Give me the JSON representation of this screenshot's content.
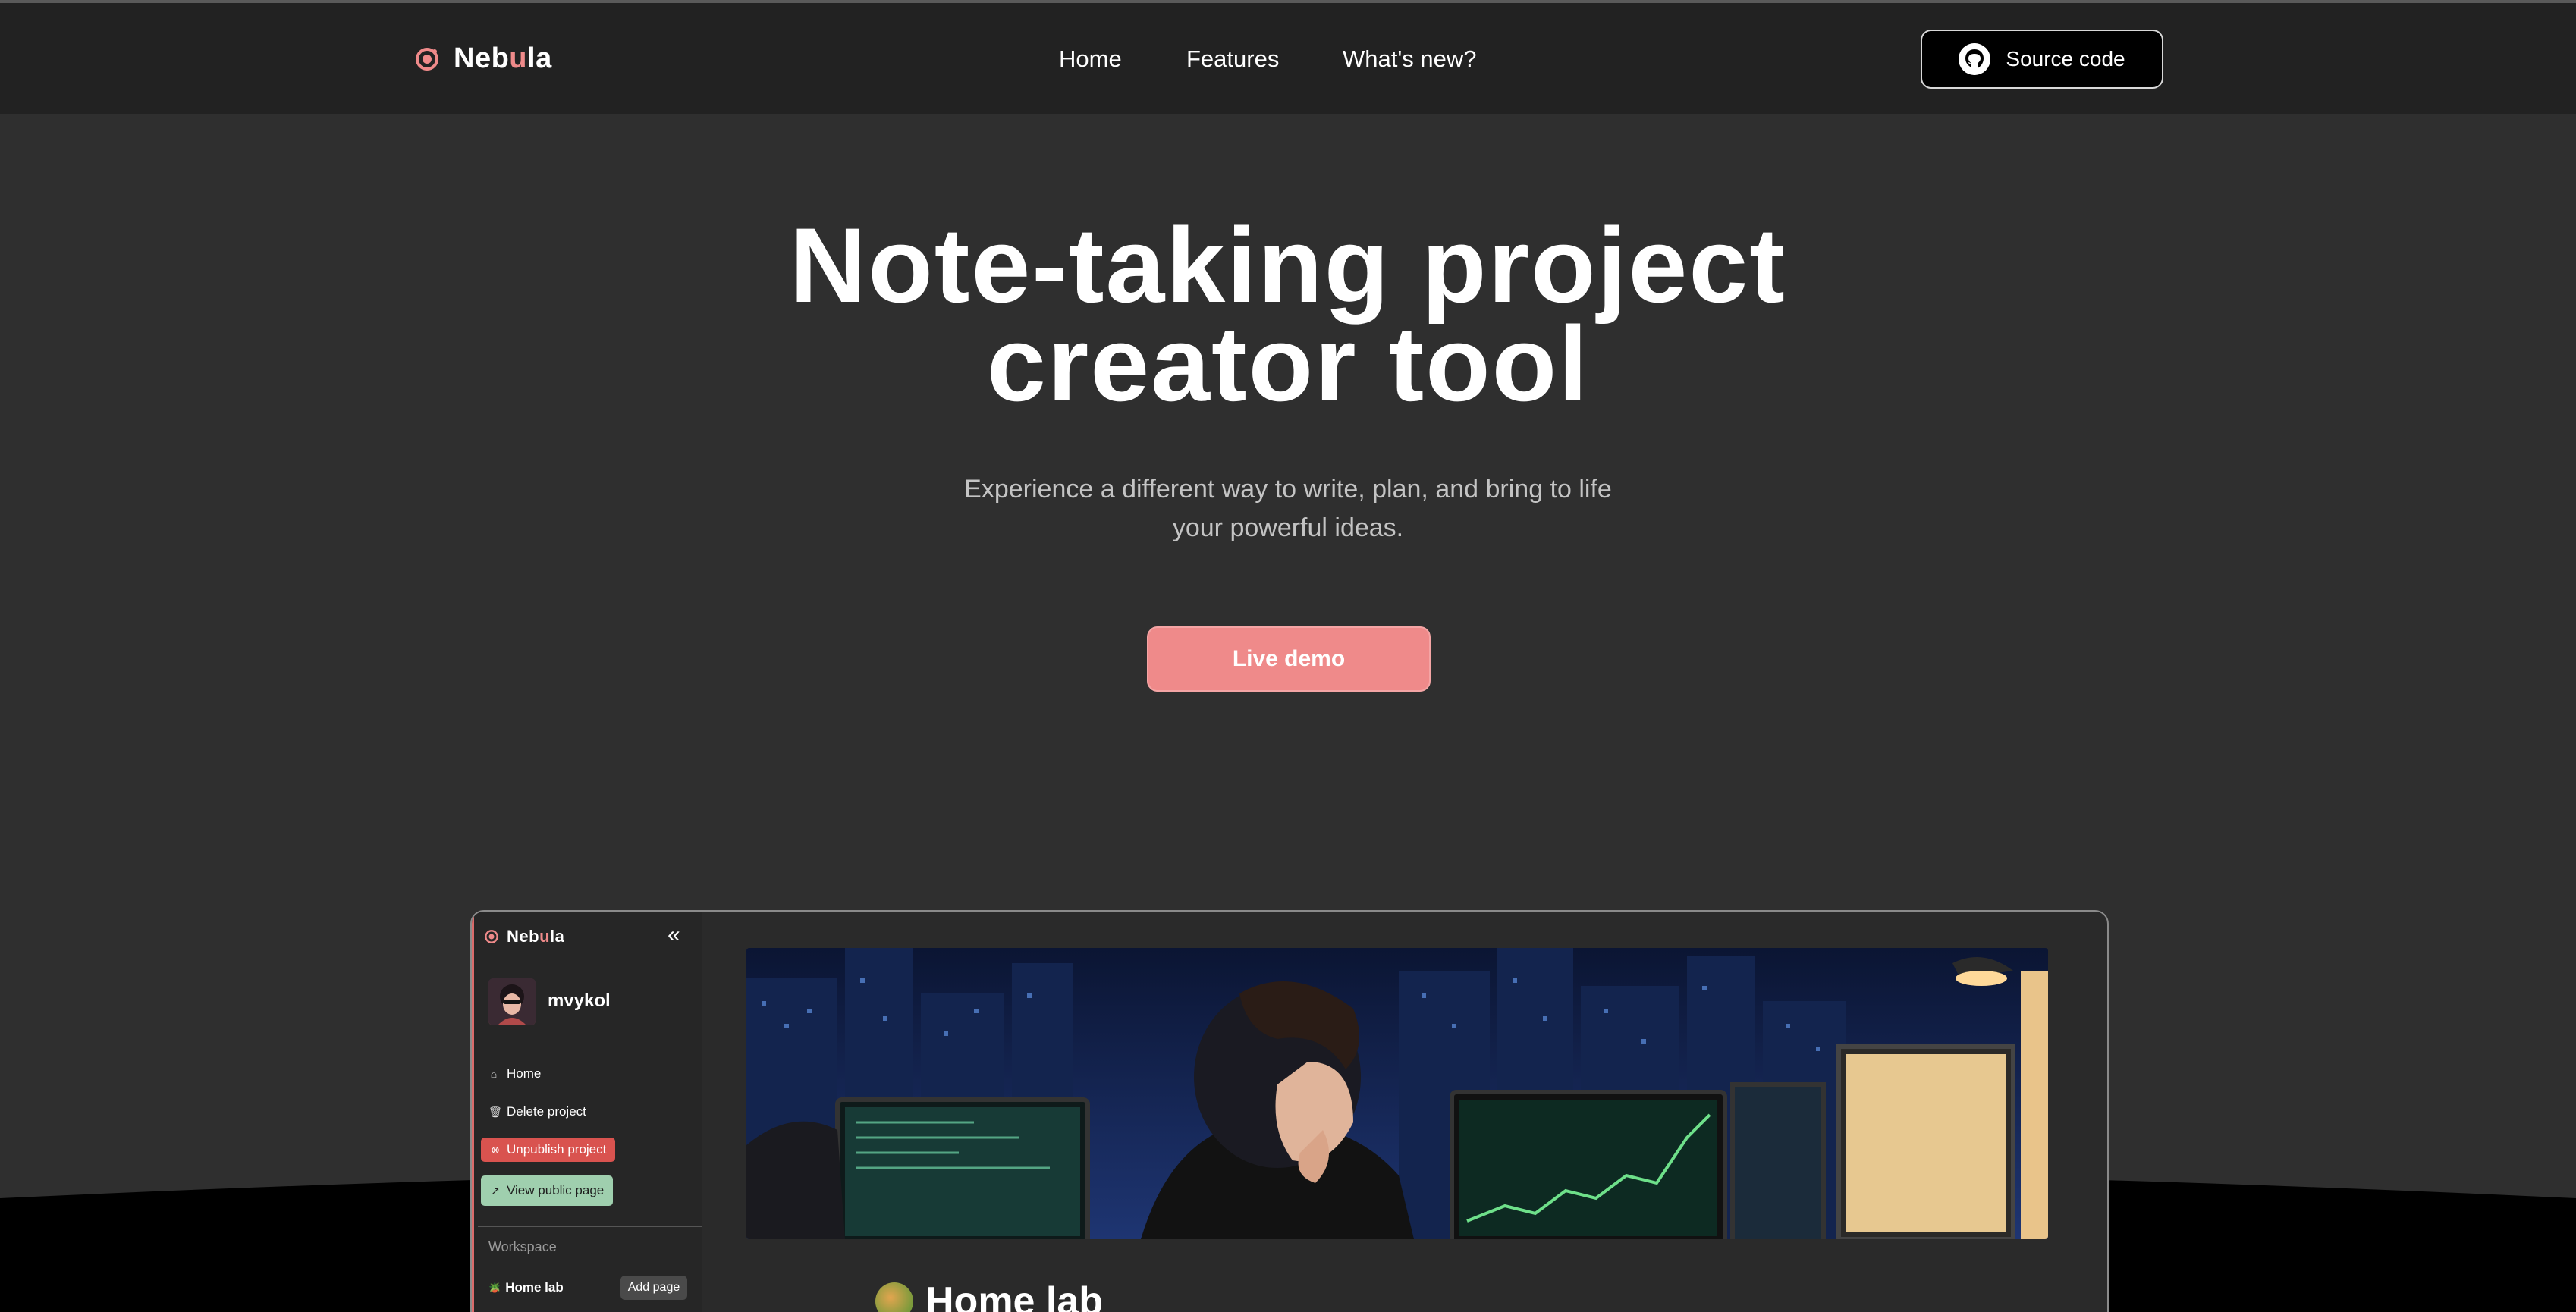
{
  "nav": {
    "brand_prefix": "Neb",
    "brand_accent": "u",
    "brand_suffix": "la",
    "links": [
      "Home",
      "Features",
      "What's new?"
    ],
    "source_label": "Source code"
  },
  "hero": {
    "title_line1": "Note-taking project",
    "title_line2": "creator tool",
    "subtitle_line1": "Experience a different way to write, plan, and bring to life",
    "subtitle_line2": "your powerful ideas.",
    "cta": "Live demo"
  },
  "preview": {
    "brand_prefix": "Neb",
    "brand_accent": "u",
    "brand_suffix": "la",
    "collapse_icon": "«",
    "username": "mvykol",
    "menu": {
      "home": "Home",
      "delete": "Delete project",
      "unpublish": "Unpublish project",
      "view_public": "View public page"
    },
    "workspace_label": "Workspace",
    "page_item": "Home lab",
    "add_page": "Add page",
    "page_title": "Home lab"
  },
  "colors": {
    "accent": "#ef8a8a",
    "background": "#2f2f2f",
    "nav_bg": "#222222",
    "danger": "#d9534f",
    "success": "#9fcfae"
  },
  "icons": [
    "nebula-logo-icon",
    "github-icon",
    "collapse-icon",
    "home-icon",
    "trash-icon",
    "unpublish-icon",
    "external-link-icon",
    "house-plant-icon"
  ]
}
